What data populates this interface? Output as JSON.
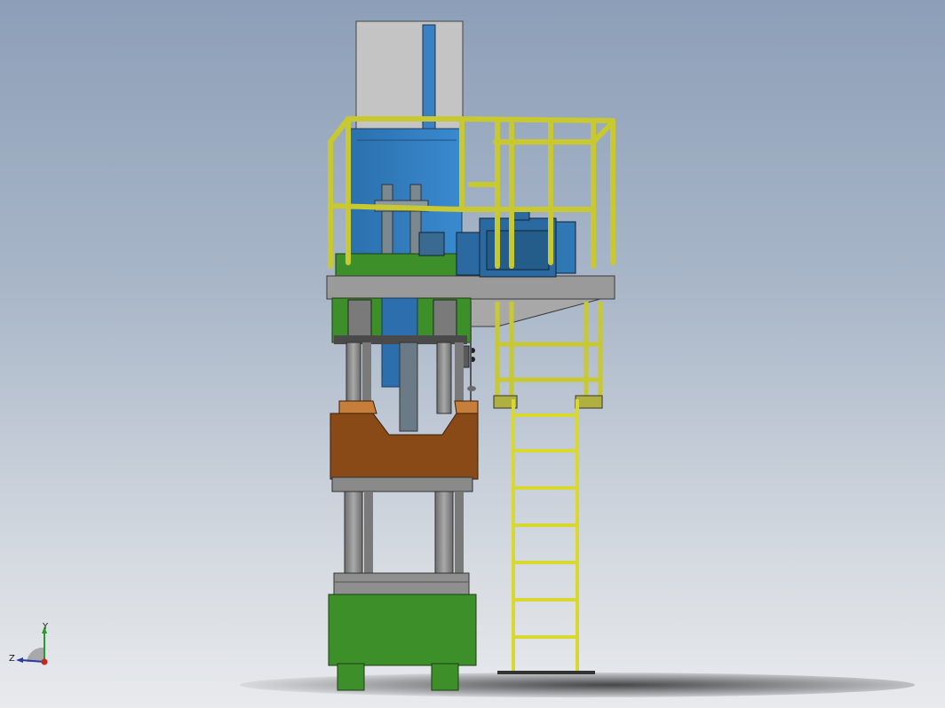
{
  "viewport": {
    "background_top": "#8d9fb8",
    "background_bottom": "#e8eaed",
    "model": {
      "hydraulic_tank_color": "#2f7fc1",
      "top_box_color": "#bfbfbf",
      "frame_green": "#3d8f2a",
      "slide_brown": "#8a4a18",
      "railing_yellow": "#e6e63a",
      "motor_blue": "#2a6aa0",
      "column_gray": "#8a8a8a",
      "platform_gray": "#9a9a9a"
    }
  },
  "triad": {
    "y_label": "Y",
    "z_label": "Z",
    "icon": "coordinate-triad-icon"
  }
}
